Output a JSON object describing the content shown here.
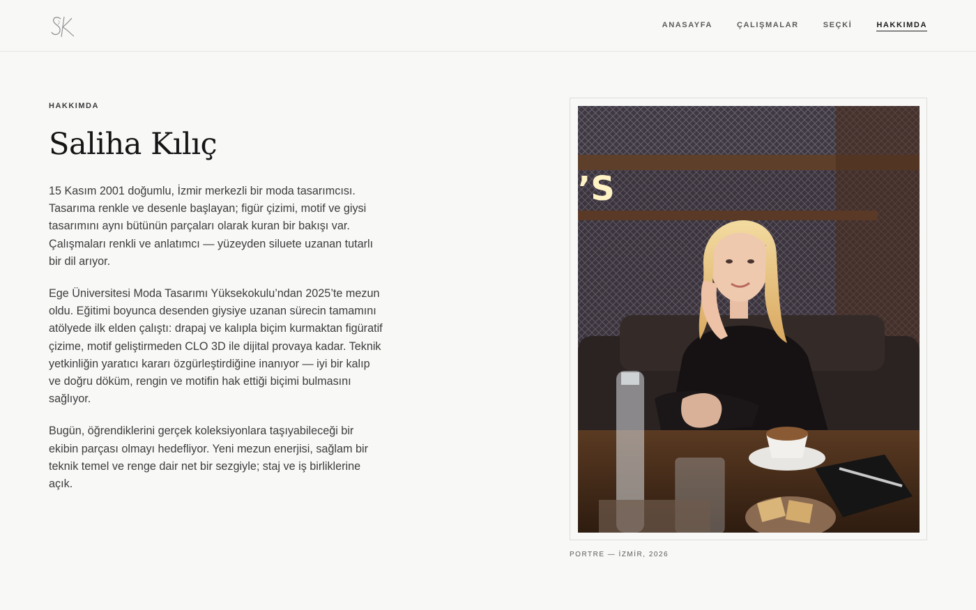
{
  "header": {
    "logo_alt": "SK",
    "nav": [
      {
        "label": "ANASAYFA"
      },
      {
        "label": "ÇALIŞMALAR"
      },
      {
        "label": "SEÇKİ"
      },
      {
        "label": "HAKKIMDA",
        "active": true
      }
    ]
  },
  "about": {
    "eyebrow": "HAKKIMDA",
    "name": "Saliha Kılıç",
    "paragraphs": [
      "15 Kasım 2001 doğumlu, İzmir merkezli bir moda tasarımcısı. Tasarıma renkle ve desenle başlayan; figür çizimi, motif ve giysi tasarımını aynı bütünün parçaları olarak kuran bir bakışı var. Çalışmaları renkli ve anlatımcı — yüzeyden siluete uzanan tutarlı bir dil arıyor.",
      "Ege Üniversitesi Moda Tasarımı Yüksekokulu’ndan 2025’te mezun oldu. Eğitimi boyunca desenden giysiye uzanan sürecin tamamını atölyede ilk elden çalıştı: drapaj ve kalıpla biçim kurmaktan figüratif çizime, motif geliştirmeden CLO 3D ile dijital provaya kadar. Teknik yetkinliğin yaratıcı kararı özgürleştirdiğine inanıyor — iyi bir kalıp ve doğru döküm, rengin ve motifin hak ettiği biçimi bulmasını sağlıyor.",
      "Bugün, öğrendiklerini gerçek koleksiyonlara taşıyabileceği bir ekibin parçası olmayı hedefliyor. Yeni mezun enerjisi, sağlam bir teknik temel ve renge dair net bir sezgiyle; staj ve iş birliklerine açık."
    ]
  },
  "portrait": {
    "sign_text": "’S",
    "caption": "PORTRE — İZMİR, 2026"
  }
}
